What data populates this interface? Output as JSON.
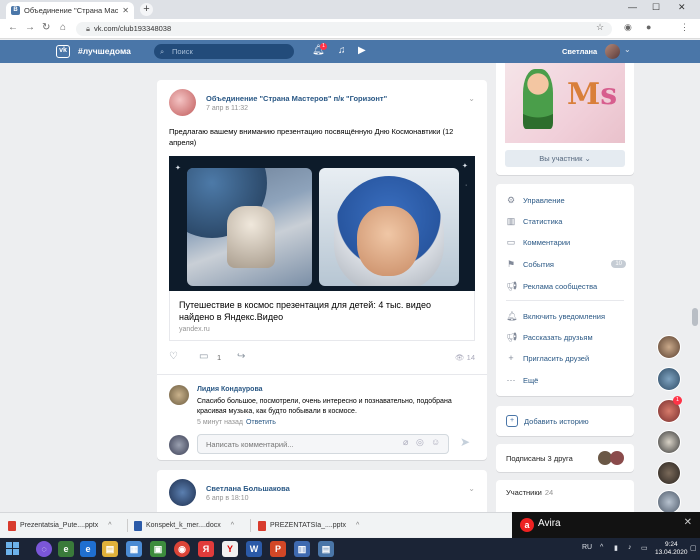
{
  "browser": {
    "tab_title": "Объединение \"Страна Мастеров\"",
    "url": "vk.com/club193348038"
  },
  "vk_header": {
    "hashtag": "#лучшедома",
    "search_placeholder": "Поиск",
    "notification_count": "1",
    "username": "Светлана"
  },
  "post": {
    "author": "Объединение \"Страна Мастеров\" п/к \"Горизонт\"",
    "date": "7 апр в 11:32",
    "text": "Предлагаю вашему вниманию презентацию посвящённую Дню Космонавтики (12 апреля)",
    "link_title": "Путешествие в космос презентация для детей: 4 тыс. видео найдено в Яндекс.Видео",
    "link_source": "yandex.ru",
    "comments_count": "1",
    "views": "14",
    "comment": {
      "author": "Лидия Кондаурова",
      "text": "Спасибо большое, посмотрели, очень интересно и познавательно, подобрана красивая музыка, как будто побывали в космосе.",
      "time": "5 минут назад",
      "reply": "Ответить"
    },
    "comment_placeholder": "Написать комментарий..."
  },
  "post2": {
    "author": "Светлана Большакова",
    "date": "6 апр в 18:10"
  },
  "sidebar": {
    "member_button": "Вы участник",
    "menu": [
      {
        "label": "Управление",
        "icon": "gear-icon"
      },
      {
        "label": "Статистика",
        "icon": "bar-chart-icon"
      },
      {
        "label": "Комментарии",
        "icon": "comment-icon"
      },
      {
        "label": "События",
        "icon": "flag-icon",
        "badge": "10"
      },
      {
        "label": "Реклама сообщества",
        "icon": "megaphone-icon"
      },
      {
        "label": "Включить уведомления",
        "icon": "bell-icon"
      },
      {
        "label": "Рассказать друзьям",
        "icon": "megaphone-icon"
      },
      {
        "label": "Пригласить друзей",
        "icon": "add-person-icon"
      },
      {
        "label": "Ещё",
        "icon": "more-icon"
      }
    ],
    "story": "Добавить историю",
    "friends": "Подписаны 3 друга",
    "members_label": "Участники",
    "members_count": "24"
  },
  "downloads": [
    {
      "name": "Prezentatsia_Pute....pptx",
      "type": "pdf"
    },
    {
      "name": "Konspekt_k_mer....docx",
      "type": "word"
    },
    {
      "name": "PREZENTATSIa_....pptx",
      "type": "pdf"
    }
  ],
  "avira": {
    "name": "Avira"
  },
  "taskbar": {
    "lang": "RU",
    "time": "9:24",
    "date": "13.04.2020"
  },
  "colors": {
    "vk_blue": "#4a76a8",
    "link_blue": "#2a5885",
    "background": "#edeef0"
  }
}
